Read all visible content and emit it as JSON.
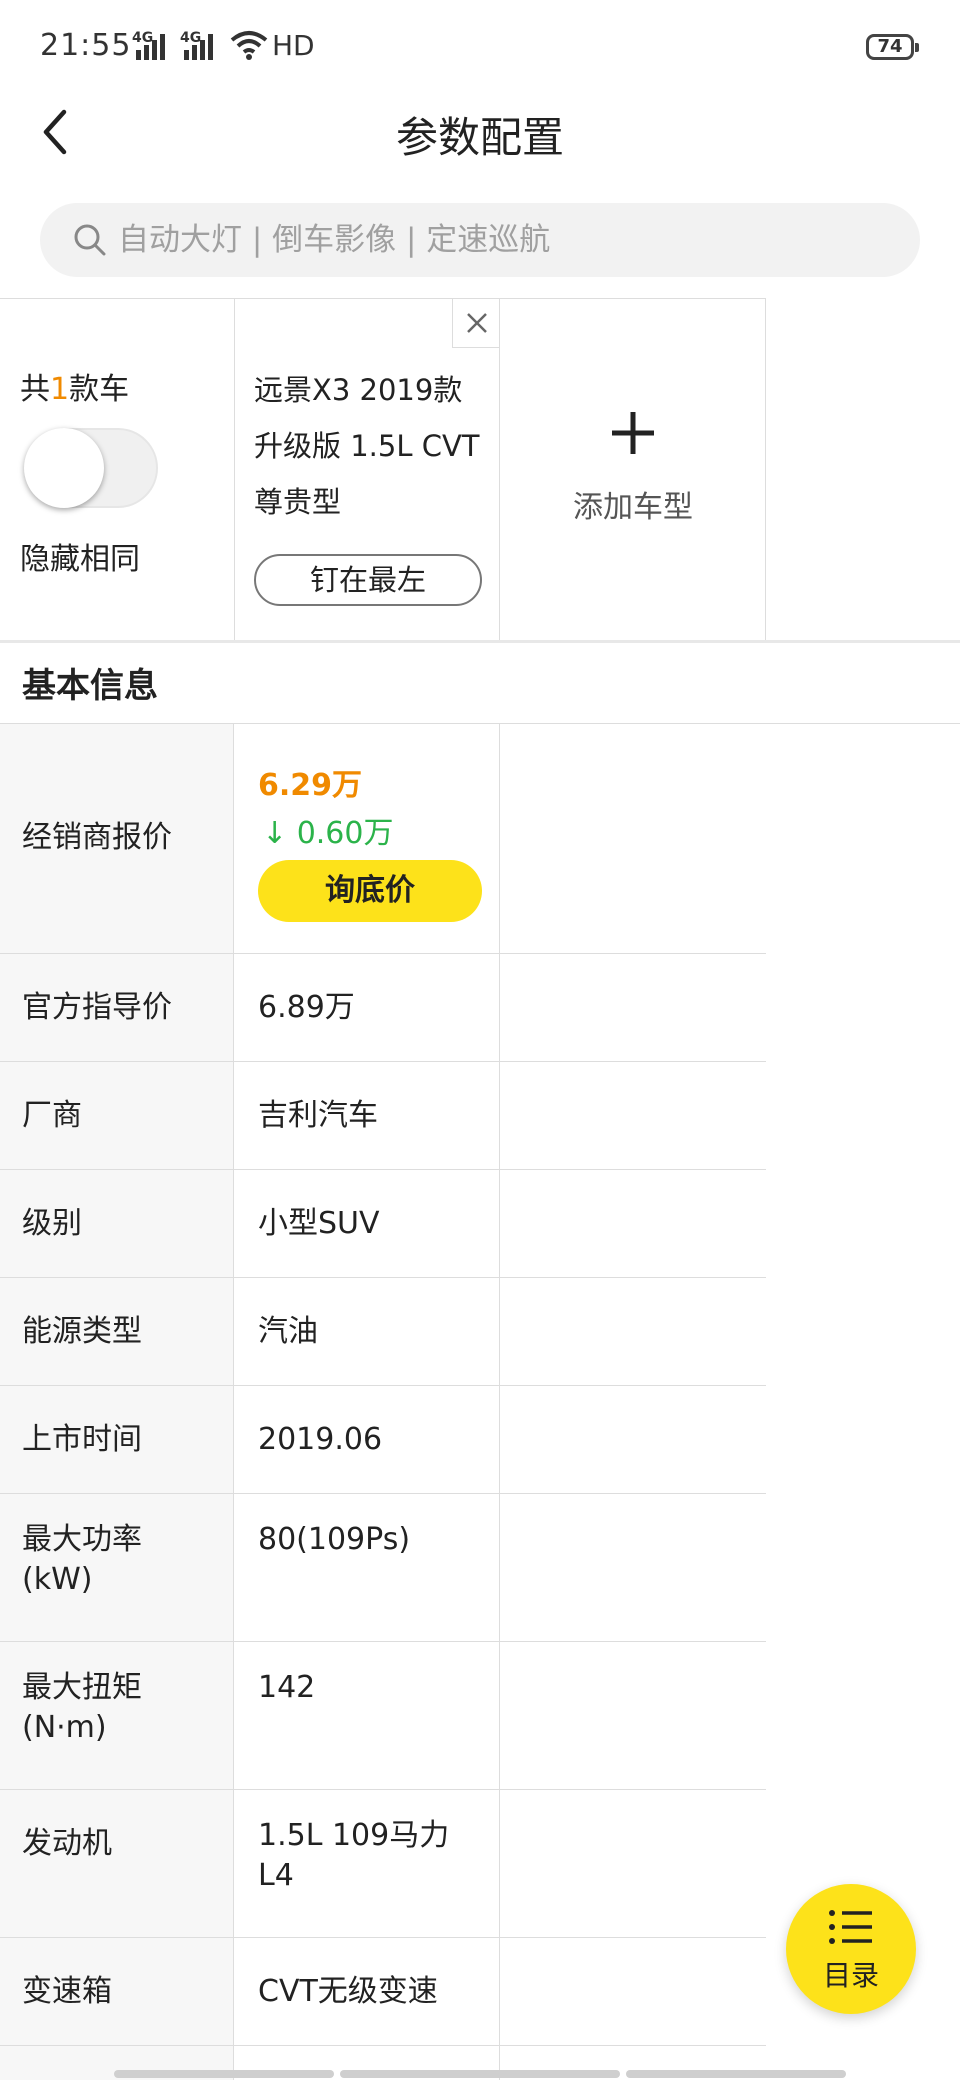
{
  "status_bar": {
    "time": "21:55",
    "network_1": "4G",
    "network_2": "4G",
    "hd": "HD",
    "battery": "74"
  },
  "nav": {
    "title": "参数配置"
  },
  "search": {
    "placeholder": "自动大灯 | 倒车影像 | 定速巡航"
  },
  "compare": {
    "count_prefix": "共",
    "count": "1",
    "count_suffix": "款车",
    "hide_same_label": "隐藏相同",
    "hide_same_on": false,
    "car_name": "远景X3 2019款 升级版 1.5L CVT尊贵型",
    "pin_label": "钉在最左",
    "add_label": "添加车型"
  },
  "section": {
    "title": "基本信息"
  },
  "dealer": {
    "label": "经销商报价",
    "price": "6.29万",
    "drop": "0.60万",
    "ask_label": "询底价"
  },
  "rows": [
    {
      "label": "官方指导价",
      "value": "6.89万"
    },
    {
      "label": "厂商",
      "value": "吉利汽车"
    },
    {
      "label": "级别",
      "value": "小型SUV"
    },
    {
      "label": "能源类型",
      "value": "汽油"
    },
    {
      "label": "上市时间",
      "value": "2019.06"
    },
    {
      "label": "最大功率\n(kW)",
      "value": "80(109Ps)"
    },
    {
      "label": "最大扭矩\n(N·m)",
      "value": "142"
    },
    {
      "label": "发动机",
      "value": "1.5L 109马力\nL4"
    },
    {
      "label": "变速箱",
      "value": "CVT无级变速"
    }
  ],
  "fab": {
    "label": "目录"
  },
  "colors": {
    "accent_yellow": "#fde21a",
    "price_orange": "#f08a00",
    "drop_green": "#2bb34a"
  }
}
